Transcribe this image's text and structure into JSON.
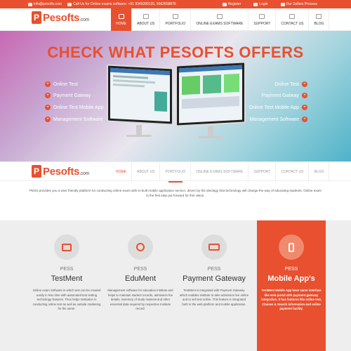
{
  "topbar": {
    "email": "info@pesofts.com",
    "phone": "Call Us for Online exams software: +91 9349289125, 9562658876",
    "register": "Register",
    "login": "Login",
    "sellers": "Our Sellers Process"
  },
  "logo": {
    "main": "Pesofts",
    "suffix": ".com",
    "letter": "P"
  },
  "nav": {
    "items": [
      "HOME",
      "ABOUT US",
      "PORTFOLIO",
      "ONLINE EXAMS SOFTWARE",
      "SUPPORT",
      "CONTACT US",
      "BLOG"
    ]
  },
  "hero": {
    "title": "CHECK WHAT PESOFTS OFFERS",
    "left_features": [
      "Online Test",
      "Payment Gatway",
      "Online Test Mobile App",
      "Management Software"
    ],
    "right_features": [
      "Online Test",
      "Payment Gatway",
      "Online Test Mobile App",
      "Management Software"
    ],
    "plus": "+"
  },
  "intro": {
    "text": "PESS provides you a user friendly platform for conducting online exam with in-built mobile application service, driven by the ideology that technology will change the way of educating students. Online exam is the first step put forward for this vision."
  },
  "services": [
    {
      "prefix": "PESS",
      "name": "TestMent",
      "desc": "Online exam Software in which test can be created easily in less time with automated test setting technology features. Thus helps Institution in conducting online test as well as outside marketing for the same.",
      "icon": "monitor-icon"
    },
    {
      "prefix": "PESS",
      "name": "EduMent",
      "desc": "Management software for education Institute and helps to maintain student records, admission fee details, inventory of study material and other essential data required by respective Institute record.",
      "icon": "people-icon"
    },
    {
      "prefix": "PESS",
      "name": "Payment Gateway",
      "desc": "TestMent is integrated with Payment Gateway which enables Institute to take admission fee online and to sell test online. This feature is integrated both in the web-platform and mobile application.",
      "icon": "card-icon"
    },
    {
      "prefix": "PESS",
      "name": "Mobile App's",
      "desc": "TestMent Mobile App have same interface like web portal with payment gateway integration. It has features like online test, Classes & Search information and online payment facility.",
      "icon": "mobile-icon"
    }
  ],
  "colors": {
    "accent": "#e8502f"
  }
}
